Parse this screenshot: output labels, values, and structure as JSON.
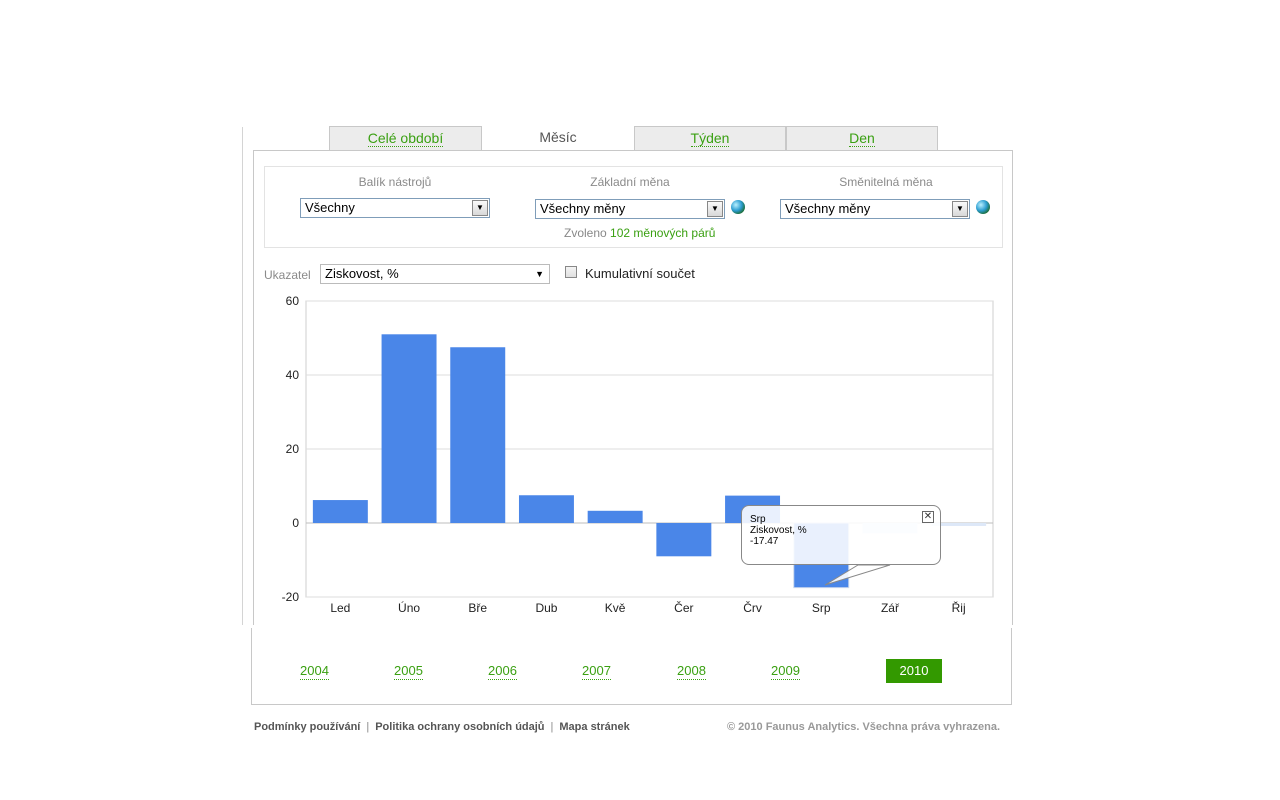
{
  "tabs": [
    {
      "label": "Celé období",
      "active": false
    },
    {
      "label": "Měsíc",
      "active": true
    },
    {
      "label": "Týden",
      "active": false
    },
    {
      "label": "Den",
      "active": false
    }
  ],
  "filters": {
    "toolset": {
      "label": "Balík nástrojů",
      "value": "Všechny"
    },
    "base_currency": {
      "label": "Základní měna",
      "value": "Všechny měny",
      "icon": "globe-icon"
    },
    "exchange_currency": {
      "label": "Směnitelná měna",
      "value": "Všechny měny",
      "icon": "globe-icon"
    },
    "selected_prefix": "Zvoleno",
    "selected_pairs": "102 měnových párů"
  },
  "indicator": {
    "label": "Ukazatel",
    "value": "Ziskovost, %",
    "cumulative_label": "Kumulativní součet",
    "cumulative_checked": false
  },
  "chart_data": {
    "type": "bar",
    "categories": [
      "Led",
      "Úno",
      "Bře",
      "Dub",
      "Kvě",
      "Čer",
      "Črv",
      "Srp",
      "Zář",
      "Řij"
    ],
    "series": [
      {
        "values": [
          6.2,
          51,
          47.5,
          7.5,
          3.3,
          -9,
          7.4,
          -17.47,
          -2.8,
          -0.8
        ]
      }
    ],
    "ylim": [
      -20,
      60
    ],
    "yticks": [
      -20,
      0,
      20,
      40,
      60
    ],
    "grid": true,
    "color": "#4a86e8",
    "highlight_color": "#dde8f8",
    "tooltip": {
      "category": "Srp",
      "series_label": "Ziskovost, %",
      "value": "-17.47"
    }
  },
  "years": {
    "items": [
      "2004",
      "2005",
      "2006",
      "2007",
      "2008",
      "2009"
    ],
    "active": "2010"
  },
  "footer": {
    "links": [
      "Podmínky používání",
      "Politika ochrany osobních údajů",
      "Mapa stránek"
    ],
    "separator": "|",
    "copyright": "© 2010 Faunus Analytics. Všechna práva vyhrazena."
  }
}
